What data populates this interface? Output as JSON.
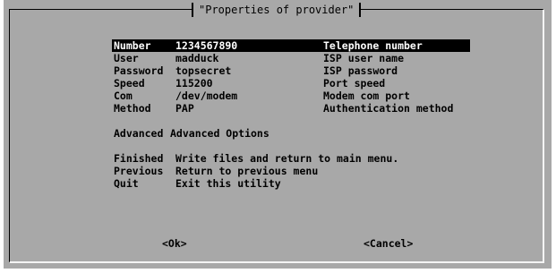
{
  "dialog": {
    "title": "\"Properties of provider\""
  },
  "items": [
    {
      "key": "Number",
      "value": "1234567890",
      "desc": "Telephone number",
      "selected": true
    },
    {
      "key": "User",
      "value": "madduck",
      "desc": "ISP user name",
      "selected": false
    },
    {
      "key": "Password",
      "value": "topsecret",
      "desc": "ISP password",
      "selected": false
    },
    {
      "key": "Speed",
      "value": "115200",
      "desc": "Port speed",
      "selected": false
    },
    {
      "key": "Com",
      "value": "/dev/modem",
      "desc": "Modem com port",
      "selected": false
    },
    {
      "key": "Method",
      "value": "PAP",
      "desc": "Authentication method",
      "selected": false
    }
  ],
  "advanced": {
    "key": "Advanced",
    "value": "Advanced Options"
  },
  "actions": [
    {
      "key": "Finished",
      "value": "Write files and return to main menu."
    },
    {
      "key": "Previous",
      "value": "Return to previous menu"
    },
    {
      "key": "Quit",
      "value": "Exit this utility"
    }
  ],
  "buttons": {
    "ok": "<Ok>",
    "cancel": "<Cancel>"
  },
  "colors": {
    "dialog_bg": "#a8a8a8",
    "selection_bg": "#000000",
    "selection_fg": "#ffffff"
  }
}
